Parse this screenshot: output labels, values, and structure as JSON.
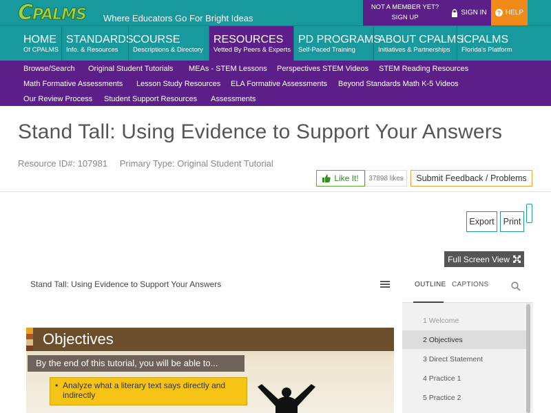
{
  "header": {
    "logo_text_c": "C",
    "logo_text_rest": "PALMS",
    "tagline": "Where Educators Go For Bright Ideas",
    "member_line1": "NOT A MEMBER YET?",
    "member_line2": "SIGN UP",
    "signin": "SIGN IN",
    "help": "HELP",
    "help_glyph": "?"
  },
  "mainnav": [
    {
      "big": "HOME",
      "small": "Of CPALMS"
    },
    {
      "big": "STANDARDS",
      "small": "Info. & Resources"
    },
    {
      "big": "COURSE",
      "small": "Descriptions & Directory"
    },
    {
      "big": "RESOURCES",
      "small": "Vetted By Peers & Experts"
    },
    {
      "big": "PD PROGRAMS",
      "small": "Self-Paced Training"
    },
    {
      "big": "ABOUT CPALMS",
      "small": "Initiatives & Partnerships"
    },
    {
      "big": "iCPALMS",
      "small": "Florida's Platform"
    }
  ],
  "subnav": [
    "Browse/Search",
    "Original Student Tutorials",
    "MEAs - STEM Lessons",
    "Perspectives STEM Videos",
    "STEM Reading Resources",
    "Math Formative Assessments",
    "Lesson Study Resources",
    "ELA Formative Assessments",
    "Beyond Standards Math K-5 Videos",
    "Our Review Process",
    "Student Support Resources",
    "Assessments"
  ],
  "resource": {
    "title": "Stand Tall: Using Evidence to Support Your Answers",
    "resource_id": "Resource ID#: 107981",
    "primary_type": "Primary Type: Original Student Tutorial"
  },
  "actions": {
    "like": "Like It!",
    "like_count": "37898 likes",
    "feedback": "Submit Feedback / Problems",
    "export": "Export",
    "print": "Print",
    "fullscreen": "Full Screen View"
  },
  "player": {
    "title": "Stand Tall: Using Evidence to Support Your Answers",
    "slide_heading": "Objectives",
    "slide_sub": "By the end of this tutorial, you will be able to...",
    "slide_bullet": "Analyze what a literary text says directly and indirectly"
  },
  "outline": {
    "tab_outline": "OUTLINE",
    "tab_captions": "CAPTIONS",
    "items": [
      "1  Welcome",
      "2  Objectives",
      "3  Direct Statement",
      "4  Practice 1",
      "5  Practice 2"
    ]
  },
  "colors": {
    "teal": "#17999e",
    "purple": "#5c1f8a",
    "orange": "#f28a1a",
    "slide_brown": "#6b4e2b",
    "bullet_yellow": "#f4c316"
  }
}
